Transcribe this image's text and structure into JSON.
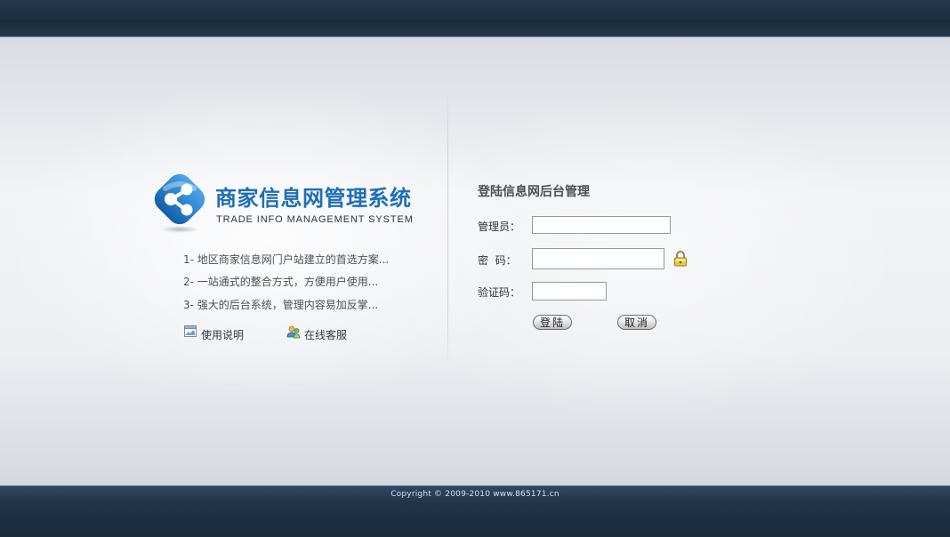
{
  "brand": {
    "title": "商家信息网管理系统",
    "subtitle": "TRADE INFO MANAGEMENT SYSTEM",
    "accent_color": "#1f6fb6",
    "logo_icon": "share-nodes-icon"
  },
  "features": [
    {
      "text": "1- 地区商家信息网门户站建立的首选方案..."
    },
    {
      "text": "2- 一站通式的整合方式，方便用户使用..."
    },
    {
      "text": "3- 强大的后台系统，管理内容易加反掌..."
    }
  ],
  "links": {
    "manual": {
      "label": "使用说明",
      "icon": "document-icon"
    },
    "support": {
      "label": "在线客服",
      "icon": "customer-service-icon"
    }
  },
  "login_form": {
    "title": "登陆信息网后台管理",
    "admin_label": "管理员：",
    "admin_value": "",
    "password_label": "密  码：",
    "password_value": "",
    "captcha_label": "验证码：",
    "captcha_value": "",
    "lock_icon": "lock-icon",
    "login_button": "登陆",
    "cancel_button": "取消"
  },
  "footer": {
    "copyright": "Copyright © 2009-2010 www.865171.cn"
  },
  "colors": {
    "header_bar": "#1b2c3d",
    "footer_bar": "#1f3348",
    "background": "#eceef2"
  }
}
